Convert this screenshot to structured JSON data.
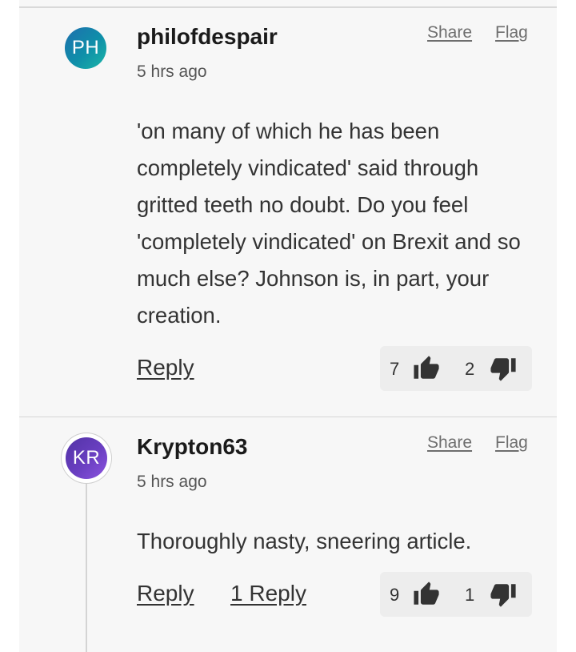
{
  "comments": [
    {
      "avatar_initials": "PH",
      "author": "philofdespair",
      "time": "5 hrs ago",
      "share_label": "Share",
      "flag_label": "Flag",
      "body": "'on many of which he has been completely vindicated' said through gritted teeth no doubt. Do you feel 'completely vindicated' on Brexit and so much else? Johnson is, in part, your creation.",
      "reply_label": "Reply",
      "upvotes": "7",
      "downvotes": "2"
    },
    {
      "avatar_initials": "KR",
      "author": "Krypton63",
      "time": "5 hrs ago",
      "share_label": "Share",
      "flag_label": "Flag",
      "body": "Thoroughly nasty, sneering article.",
      "reply_label": "Reply",
      "replies_label": "1 Reply",
      "upvotes": "9",
      "downvotes": "1"
    }
  ],
  "colors": {
    "panel_bg": "#f7f7f7",
    "vote_bg": "#ededed",
    "avatar_ph": "#1b8aa8",
    "avatar_kr": "#6a3fc1"
  },
  "icons": {
    "upvote": "thumbs-up-icon",
    "downvote": "thumbs-down-icon"
  }
}
